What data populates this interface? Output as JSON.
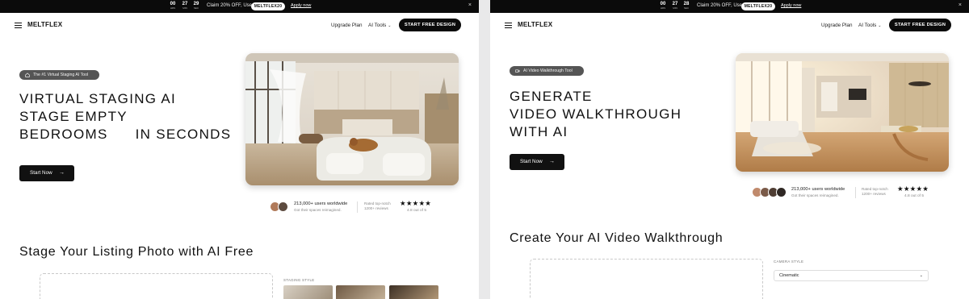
{
  "panels": [
    {
      "promo": {
        "countdown": [
          {
            "value": "00",
            "unit": "HRS"
          },
          {
            "value": "27",
            "unit": "MIN"
          },
          {
            "value": "29",
            "unit": "SEC"
          }
        ],
        "text": "Claim 20% OFF, Use:",
        "code": "MELTFLEX20",
        "apply": "Apply now",
        "close": "×"
      },
      "nav": {
        "brand": "MELTFLEX",
        "upgrade": "Upgrade Plan",
        "ai_tools": "AI Tools",
        "cta": "START FREE DESIGN"
      },
      "hero": {
        "badge": "The #1 Virtual Staging AI Tool",
        "headline": [
          "VIRTUAL STAGING AI",
          "STAGE EMPTY",
          "BEDROOMS",
          "IN SECONDS"
        ],
        "start": "Start Now"
      },
      "proof": {
        "users": "213,000+ users worldwide",
        "users_sub": "Got their spaces reimagined.",
        "rated": "Rated top-notch",
        "reviews": "1200+ reviews",
        "stars": "★★★★★",
        "rating": "4.8 out of 5"
      },
      "section": {
        "title": "Stage Your Listing Photo with AI Free",
        "label": "STAGING STYLE"
      }
    },
    {
      "promo": {
        "countdown": [
          {
            "value": "00",
            "unit": "HRS"
          },
          {
            "value": "27",
            "unit": "MIN"
          },
          {
            "value": "28",
            "unit": "SEC"
          }
        ],
        "text": "Claim 20% OFF, Use:",
        "code": "MELTFLEX20",
        "apply": "Apply now",
        "close": "×"
      },
      "nav": {
        "brand": "MELTFLEX",
        "upgrade": "Upgrade Plan",
        "ai_tools": "AI Tools",
        "cta": "START FREE DESIGN"
      },
      "hero": {
        "badge": "AI Video Walkthrough Tool",
        "headline": [
          "GENERATE",
          "VIDEO WALKTHROUGH",
          "WITH AI"
        ],
        "start": "Start Now"
      },
      "proof": {
        "users": "213,000+ users worldwide",
        "users_sub": "Got their spaces reimagined.",
        "rated": "Rated top-notch",
        "reviews": "1200+ reviews",
        "stars": "★★★★★",
        "rating": "4.8 out of 5"
      },
      "section": {
        "title": "Create Your AI Video Walkthrough",
        "label": "CAMERA STYLE",
        "select_value": "Cinematic"
      }
    }
  ]
}
